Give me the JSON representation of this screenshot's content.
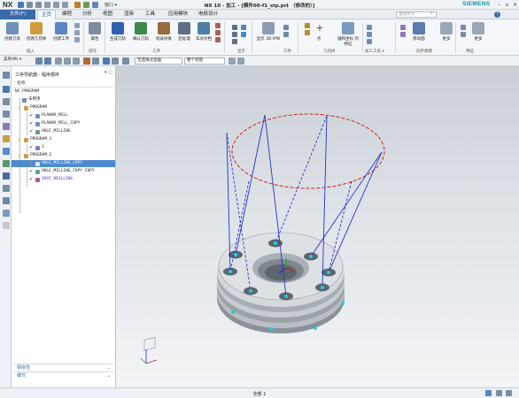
{
  "app": {
    "logo": "NX",
    "title": "NX 10 - 加工 - [模件00-f1_stp.prt （修改的）]",
    "window_menu": "窗口 ▾",
    "brand": "SIEMENS"
  },
  "menu": {
    "file": "文件(F)",
    "tabs": [
      "主页",
      "编程",
      "分析",
      "视图",
      "渲染",
      "工具",
      "应用模块",
      "电极设计"
    ],
    "active_tab": "主页",
    "search_placeholder": "查找命令"
  },
  "ribbon": {
    "buttons": [
      {
        "label": "创建刀具",
        "icon": "create-tool-icon"
      },
      {
        "label": "创建几何体",
        "icon": "create-geometry-icon"
      },
      {
        "label": "创建工序",
        "icon": "create-operation-icon"
      },
      {
        "label": "属性",
        "icon": "properties-icon"
      },
      {
        "label": "生成刀轨",
        "icon": "generate-toolpath-icon"
      },
      {
        "label": "确认刀轨",
        "icon": "verify-toolpath-icon"
      },
      {
        "label": "机床仿真",
        "icon": "machine-simulation-icon"
      },
      {
        "label": "后处理",
        "icon": "postprocess-icon"
      },
      {
        "label": "车间文档",
        "icon": "shop-doc-icon"
      },
      {
        "label": "显示 3D IPW",
        "icon": "ipw-icon"
      },
      {
        "label": "点",
        "icon": "point-icon"
      },
      {
        "label": "轴和坐标 的特征",
        "icon": "axis-csys-icon"
      },
      {
        "label": "移动面",
        "icon": "move-face-icon"
      },
      {
        "label": "更多",
        "icon": "more-icon"
      },
      {
        "label": "更多",
        "icon": "more-icon-2"
      }
    ],
    "groups": [
      "插入",
      "操作",
      "工序",
      "显示",
      "工件",
      "几何体",
      "加工工具 ▾",
      "同步建模",
      "特征"
    ]
  },
  "selection_bar": {
    "menu": "菜单(M) ▾",
    "filter": "无选择过滤器",
    "scope": "整个装配"
  },
  "navigator": {
    "title": "工序导航器 - 程序顺序",
    "column": "名称",
    "nodes": [
      {
        "label": "NC_PROGRAM",
        "depth": 0,
        "status": "none"
      },
      {
        "label": "未用项",
        "depth": 1,
        "status": "none"
      },
      {
        "label": "PROGRAM",
        "depth": 1,
        "status": "key"
      },
      {
        "label": "PLANAR_MILL",
        "depth": 2,
        "status": "check"
      },
      {
        "label": "PLANAR_MILL_COPY",
        "depth": 2,
        "status": "check"
      },
      {
        "label": "HOLE_MILLING",
        "depth": 2,
        "status": "check"
      },
      {
        "label": "PROGRAM_1",
        "depth": 1,
        "status": "key"
      },
      {
        "label": "1",
        "depth": 2,
        "status": "check"
      },
      {
        "label": "PROGRAM_2",
        "depth": 1,
        "status": "key"
      },
      {
        "label": "HOLE_MILLING_COPY",
        "depth": 2,
        "status": "key",
        "selected": true
      },
      {
        "label": "HOLE_MILLING_COPY_COPY",
        "depth": 2,
        "status": "check"
      },
      {
        "label": "SPOT_DRILLING",
        "depth": 2,
        "status": "check"
      }
    ],
    "panels": [
      "相依性",
      "细节"
    ]
  },
  "status": {
    "text": "全部 1"
  },
  "colors": {
    "accent": "#3a6aa8",
    "selection": "#4e8ad0",
    "toolpath": "#2233cc",
    "rapid": "#cc2222",
    "check": "#2b9a2b"
  }
}
